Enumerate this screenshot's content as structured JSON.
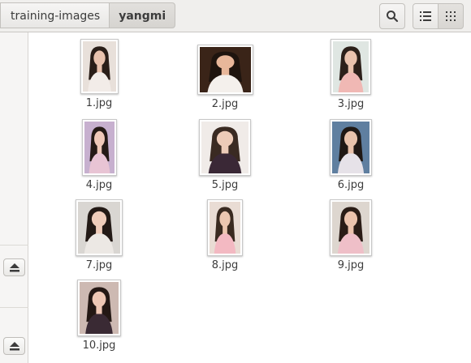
{
  "pathbar": {
    "parent": "training-images",
    "current": "yangmi"
  },
  "toolbar": {
    "search_icon": "search-icon",
    "list_icon": "list-view-icon",
    "grid_icon": "grid-view-icon"
  },
  "sidebar": {
    "eject_icon": "eject-icon"
  },
  "files": [
    {
      "name": "1.jpg",
      "bg": "#e8e0da",
      "skin": "#e9c3ae",
      "hair": "#2a1e18",
      "cloth": "#f2ece8"
    },
    {
      "name": "2.jpg",
      "bg": "#3a2418",
      "skin": "#e8b79a",
      "hair": "#1e140e",
      "cloth": "#f4f0ec"
    },
    {
      "name": "3.jpg",
      "bg": "#dfe6e2",
      "skin": "#eac3ae",
      "hair": "#2c201a",
      "cloth": "#f0b8b4"
    },
    {
      "name": "4.jpg",
      "bg": "#c7b0cf",
      "skin": "#efc8b8",
      "hair": "#251a16",
      "cloth": "#e8c4d4"
    },
    {
      "name": "5.jpg",
      "bg": "#f0ebe8",
      "skin": "#edcbb8",
      "hair": "#3a2a22",
      "cloth": "#3a2836"
    },
    {
      "name": "6.jpg",
      "bg": "#5f7fa0",
      "skin": "#e8c2ab",
      "hair": "#1f1814",
      "cloth": "#e6e2e8"
    },
    {
      "name": "7.jpg",
      "bg": "#d9d6d2",
      "skin": "#efcdbb",
      "hair": "#231a16",
      "cloth": "#ece8e4"
    },
    {
      "name": "8.jpg",
      "bg": "#e9dcd4",
      "skin": "#ecc6b0",
      "hair": "#3a2a20",
      "cloth": "#f3b9c2"
    },
    {
      "name": "9.jpg",
      "bg": "#ddd6cf",
      "skin": "#ecc3ad",
      "hair": "#2a1c16",
      "cloth": "#efbfc8"
    },
    {
      "name": "10.jpg",
      "bg": "#cdb9b2",
      "skin": "#eec7b4",
      "hair": "#241814",
      "cloth": "#3a2a34"
    }
  ]
}
